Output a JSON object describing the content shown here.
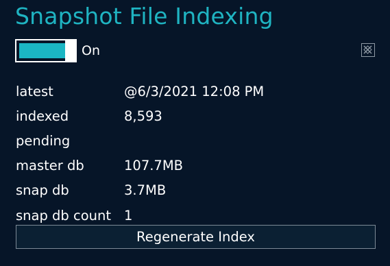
{
  "title": "Snapshot File Indexing",
  "toggle": {
    "state_label": "On",
    "on": true
  },
  "close_icon": "close-x-icon",
  "info": [
    {
      "key": "latest",
      "value": "@6/3/2021 12:08 PM"
    },
    {
      "key": "indexed",
      "value": "8,593"
    },
    {
      "key": "pending",
      "value": ""
    },
    {
      "key": "master db",
      "value": "107.7MB"
    },
    {
      "key": "snap db",
      "value": "3.7MB"
    },
    {
      "key": "snap db count",
      "value": "1"
    }
  ],
  "regenerate_label": "Regenerate Index",
  "colors": {
    "background": "#061528",
    "accent": "#1fb4c2",
    "text": "#ffffff"
  }
}
